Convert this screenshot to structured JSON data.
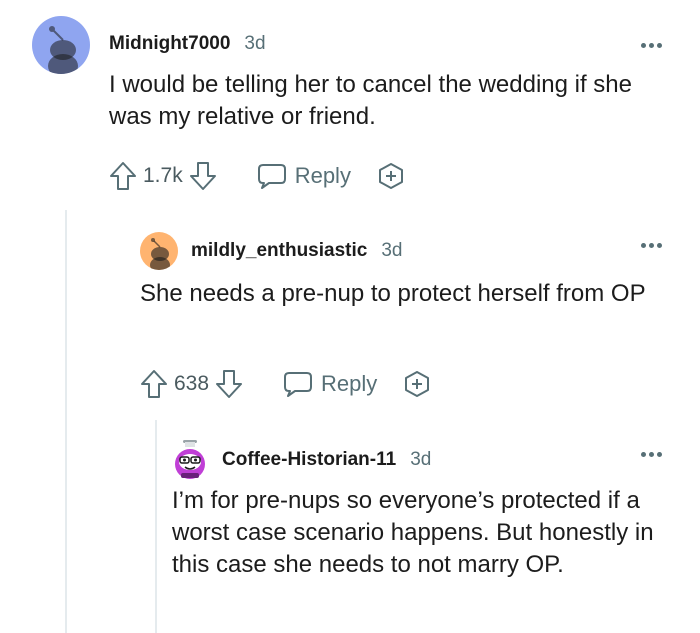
{
  "comments": [
    {
      "username": "Midnight7000",
      "time": "3d",
      "body": "I would be telling her to cancel the wedding if she was my relative or friend.",
      "score": "1.7k",
      "reply_label": "Reply",
      "avatar_color": "#8fa5f0"
    },
    {
      "username": "mildly_enthusiastic",
      "time": "3d",
      "body": "She needs a pre-nup to protect herself from OP",
      "score": "638",
      "reply_label": "Reply",
      "avatar_color": "#ffb470"
    },
    {
      "username": "Coffee-Historian-11",
      "time": "3d",
      "body": "I’m for pre-nups so everyone’s protected if a worst case scenario happens. But honestly in this case she needs to not marry OP.",
      "avatar_color": "#c03fd6"
    }
  ],
  "icons": {
    "upvote": "upvote-arrow-icon",
    "downvote": "downvote-arrow-icon",
    "reply": "speech-bubble-icon",
    "award": "award-plus-icon",
    "more": "more-dots-icon"
  }
}
